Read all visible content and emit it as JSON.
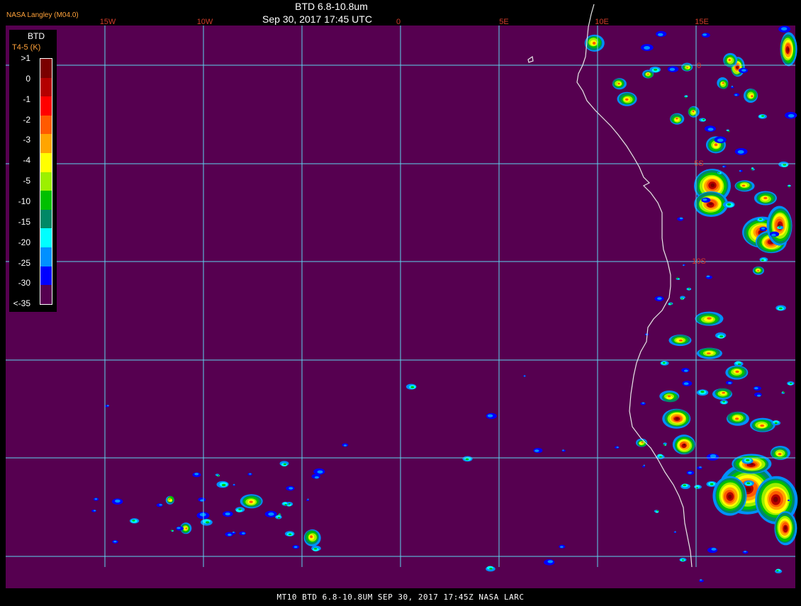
{
  "header": {
    "title": "BTD 6.8-10.8um",
    "timestamp": "Sep 30, 2017 17:45 UTC",
    "source": "NASA Langley (M04.0)"
  },
  "footer": {
    "caption": "MT10  BTD 6.8-10.8UM   SEP 30, 2017 17:45Z   NASA LARC"
  },
  "map": {
    "background_color": "#560050",
    "grid_color": "#5fd6ee",
    "coastline_color": "#e8e8e8",
    "label_color": "#d23c2a",
    "lon_labels": [
      "15W",
      "10W",
      "0",
      "5E",
      "10E",
      "15E"
    ],
    "lat_labels": [
      "0",
      "5S",
      "10S"
    ]
  },
  "legend": {
    "title": "BTD",
    "subtitle": "T4-5 (K)",
    "ticks": [
      ">1",
      "0",
      "-1",
      "-2",
      "-3",
      "-4",
      "-5",
      "-10",
      "-15",
      "-20",
      "-25",
      "-30",
      "<-35"
    ],
    "colors": [
      "#7a0000",
      "#b40000",
      "#ff0000",
      "#ff5a00",
      "#ffa500",
      "#ffff00",
      "#9cf000",
      "#00c000",
      "#008866",
      "#00ffff",
      "#0090ff",
      "#0000ff",
      "#560050"
    ]
  }
}
